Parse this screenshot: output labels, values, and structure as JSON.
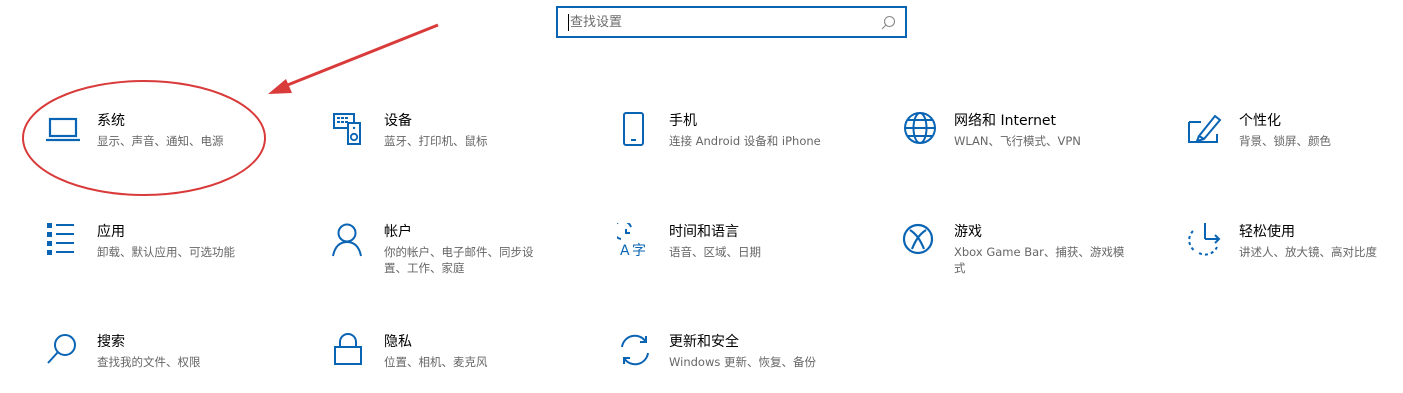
{
  "search": {
    "placeholder": "查找设置"
  },
  "tiles": [
    {
      "title": "系统",
      "desc": "显示、声音、通知、电源",
      "icon": "laptop-icon"
    },
    {
      "title": "设备",
      "desc": "蓝牙、打印机、鼠标",
      "icon": "keyboard-speaker-icon"
    },
    {
      "title": "手机",
      "desc": "连接 Android 设备和 iPhone",
      "icon": "phone-icon"
    },
    {
      "title": "网络和 Internet",
      "desc": "WLAN、飞行模式、VPN",
      "icon": "globe-icon"
    },
    {
      "title": "个性化",
      "desc": "背景、锁屏、颜色",
      "icon": "pen-tablet-icon"
    },
    {
      "title": "应用",
      "desc": "卸载、默认应用、可选功能",
      "icon": "apps-list-icon"
    },
    {
      "title": "帐户",
      "desc": "你的帐户、电子邮件、同步设置、工作、家庭",
      "icon": "person-icon"
    },
    {
      "title": "时间和语言",
      "desc": "语音、区域、日期",
      "icon": "time-language-icon"
    },
    {
      "title": "游戏",
      "desc": "Xbox Game Bar、捕获、游戏模式",
      "icon": "xbox-icon"
    },
    {
      "title": "轻松使用",
      "desc": "讲述人、放大镜、高对比度",
      "icon": "ease-of-access-icon"
    },
    {
      "title": "搜索",
      "desc": "查找我的文件、权限",
      "icon": "search-icon"
    },
    {
      "title": "隐私",
      "desc": "位置、相机、麦克风",
      "icon": "lock-icon"
    },
    {
      "title": "更新和安全",
      "desc": "Windows 更新、恢复、备份",
      "icon": "sync-icon"
    }
  ],
  "colors": {
    "accent": "#0a64b4",
    "annotation": "#d93a3a",
    "title": "#000000",
    "desc": "#666666"
  }
}
